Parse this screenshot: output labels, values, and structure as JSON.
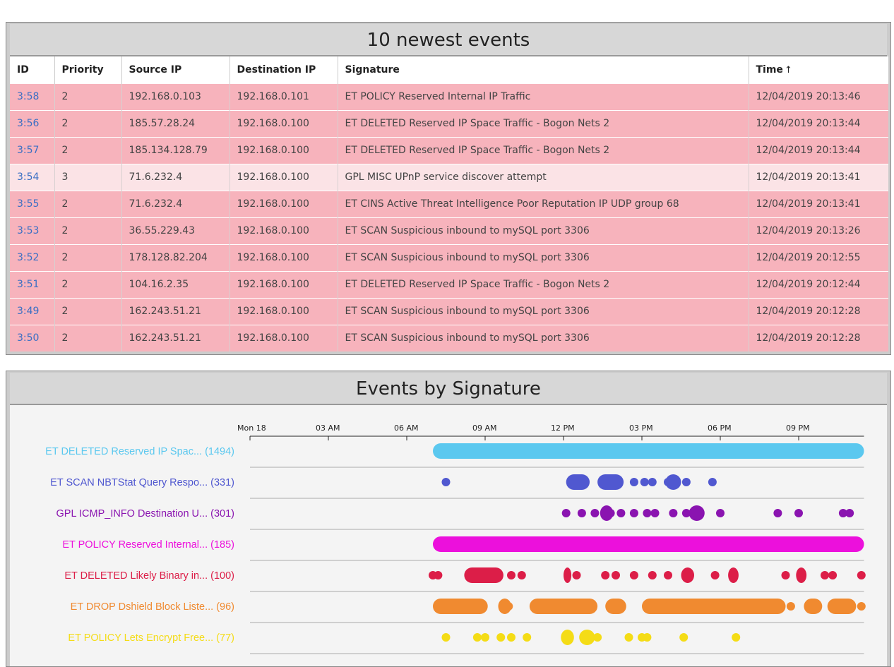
{
  "events_panel": {
    "title": "10 newest events",
    "columns": [
      "ID",
      "Priority",
      "Source IP",
      "Destination IP",
      "Signature",
      "Time"
    ],
    "sort_indicator": "↑",
    "rows": [
      {
        "id": "3:58",
        "priority": "2",
        "src": "192.168.0.103",
        "dst": "192.168.0.101",
        "signature": "ET POLICY Reserved Internal IP Traffic",
        "time": "12/04/2019 20:13:46"
      },
      {
        "id": "3:56",
        "priority": "2",
        "src": "185.57.28.24",
        "dst": "192.168.0.100",
        "signature": "ET DELETED Reserved IP Space Traffic - Bogon Nets 2",
        "time": "12/04/2019 20:13:44"
      },
      {
        "id": "3:57",
        "priority": "2",
        "src": "185.134.128.79",
        "dst": "192.168.0.100",
        "signature": "ET DELETED Reserved IP Space Traffic - Bogon Nets 2",
        "time": "12/04/2019 20:13:44"
      },
      {
        "id": "3:54",
        "priority": "3",
        "src": "71.6.232.4",
        "dst": "192.168.0.100",
        "signature": "GPL MISC UPnP service discover attempt",
        "time": "12/04/2019 20:13:41"
      },
      {
        "id": "3:55",
        "priority": "2",
        "src": "71.6.232.4",
        "dst": "192.168.0.100",
        "signature": "ET CINS Active Threat Intelligence Poor Reputation IP UDP group 68",
        "time": "12/04/2019 20:13:41"
      },
      {
        "id": "3:53",
        "priority": "2",
        "src": "36.55.229.43",
        "dst": "192.168.0.100",
        "signature": "ET SCAN Suspicious inbound to mySQL port 3306",
        "time": "12/04/2019 20:13:26"
      },
      {
        "id": "3:52",
        "priority": "2",
        "src": "178.128.82.204",
        "dst": "192.168.0.100",
        "signature": "ET SCAN Suspicious inbound to mySQL port 3306",
        "time": "12/04/2019 20:12:55"
      },
      {
        "id": "3:51",
        "priority": "2",
        "src": "104.16.2.35",
        "dst": "192.168.0.100",
        "signature": "ET DELETED Reserved IP Space Traffic - Bogon Nets 2",
        "time": "12/04/2019 20:12:44"
      },
      {
        "id": "3:49",
        "priority": "2",
        "src": "162.243.51.21",
        "dst": "192.168.0.100",
        "signature": "ET SCAN Suspicious inbound to mySQL port 3306",
        "time": "12/04/2019 20:12:28"
      },
      {
        "id": "3:50",
        "priority": "2",
        "src": "162.243.51.21",
        "dst": "192.168.0.100",
        "signature": "ET SCAN Suspicious inbound to mySQL port 3306",
        "time": "12/04/2019 20:12:28"
      }
    ],
    "colors": {
      "priority_2": "#f7b3bc",
      "priority_3": "#fbe3e6",
      "id_link": "#3a6fc4"
    }
  },
  "signature_panel": {
    "title": "Events by Signature",
    "chart_data": {
      "type": "scatter",
      "x_unit": "hours since Mon 18 00:00",
      "xlim": [
        0,
        23.5
      ],
      "x_ticks": [
        {
          "label": "Mon 18",
          "hour": 0
        },
        {
          "label": "03 AM",
          "hour": 3
        },
        {
          "label": "06 AM",
          "hour": 6
        },
        {
          "label": "09 AM",
          "hour": 9
        },
        {
          "label": "12 PM",
          "hour": 12
        },
        {
          "label": "03 PM",
          "hour": 15
        },
        {
          "label": "06 PM",
          "hour": 18
        },
        {
          "label": "09 PM",
          "hour": 21
        }
      ],
      "series": [
        {
          "label": "ET DELETED Reserved IP Spac... (1494)",
          "color": "#5bc8ef",
          "spans": [
            [
              7.0,
              23.5
            ]
          ],
          "points": []
        },
        {
          "label": "ET SCAN NBTStat Query Respo... (331)",
          "color": "#5058d0",
          "spans": [
            [
              12.1,
              13.0
            ],
            [
              13.3,
              14.3
            ],
            [
              15.9,
              16.5
            ]
          ],
          "points": [
            7.5,
            14.7,
            15.1,
            15.4,
            16.0,
            16.7,
            17.7
          ]
        },
        {
          "label": "GPL ICMP_INFO Destination U... (301)",
          "color": "#8a14b0",
          "spans": [
            [
              13.4,
              13.9
            ],
            [
              16.8,
              17.4
            ]
          ],
          "points": [
            12.1,
            12.7,
            13.2,
            13.8,
            14.2,
            14.7,
            15.2,
            15.5,
            16.2,
            16.7,
            18.0,
            20.2,
            21.0,
            22.7,
            22.95
          ]
        },
        {
          "label": "ET POLICY Reserved Internal... (185)",
          "color": "#ec10dc",
          "spans": [
            [
              7.0,
              23.5
            ]
          ],
          "points": []
        },
        {
          "label": "ET DELETED Likely Binary in... (100)",
          "color": "#dc1e48",
          "spans": [
            [
              8.2,
              9.7
            ],
            [
              12.0,
              12.3
            ],
            [
              16.5,
              17.0
            ],
            [
              18.3,
              18.7
            ],
            [
              20.9,
              21.3
            ]
          ],
          "points": [
            7.0,
            7.2,
            10.0,
            10.4,
            12.5,
            13.6,
            14.0,
            14.7,
            15.4,
            16.0,
            17.8,
            20.5,
            22.0,
            22.3,
            23.4
          ]
        },
        {
          "label": "ET DROP Dshield Block Liste... (96)",
          "color": "#f08a30",
          "spans": [
            [
              7.0,
              9.1
            ],
            [
              9.5,
              10.0
            ],
            [
              10.7,
              13.3
            ],
            [
              13.6,
              14.4
            ],
            [
              15.0,
              20.5
            ],
            [
              21.2,
              21.9
            ],
            [
              22.1,
              23.2
            ]
          ],
          "points": [
            9.9,
            16.0,
            20.7,
            23.4
          ]
        },
        {
          "label": "ET POLICY Lets Encrypt Free... (77)",
          "color": "#f4dc16",
          "spans": [
            [
              11.9,
              12.4
            ],
            [
              12.6,
              13.2
            ]
          ],
          "points": [
            7.5,
            8.7,
            9.0,
            9.6,
            10.0,
            10.6,
            12.8,
            13.3,
            14.5,
            15.0,
            15.2,
            16.6,
            18.6
          ]
        }
      ]
    }
  }
}
